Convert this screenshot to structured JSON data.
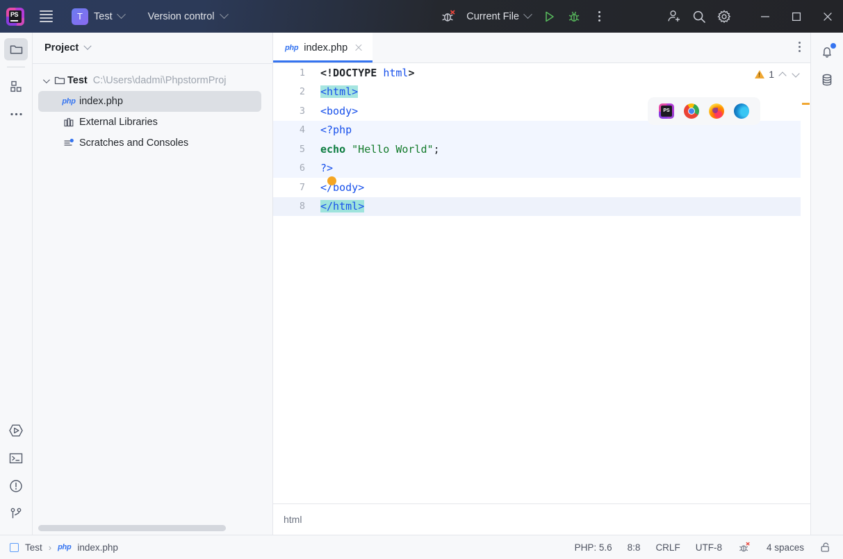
{
  "titlebar": {
    "logo_name": "phpstorm-logo",
    "hamburger_label": "Main Menu",
    "project_initial": "T",
    "project_name": "Test",
    "vcs_label": "Version control",
    "debug_icon_name": "debug-attach-icon",
    "run_config_label": "Current File",
    "run_label": "Run",
    "debug_label": "Debug",
    "more_label": "More Actions",
    "account_label": "Account",
    "search_label": "Search Everywhere",
    "settings_label": "Settings",
    "minimize_label": "Minimize",
    "maximize_label": "Maximize",
    "close_label": "Close"
  },
  "left_rail": {
    "items": [
      {
        "name": "project-tool-window",
        "icon": "folder-icon",
        "active": true
      },
      {
        "name": "commit-tool-window",
        "icon": "structure-icon",
        "active": false
      },
      {
        "name": "more-tool-windows",
        "icon": "more-dots-icon",
        "active": false
      }
    ],
    "bottom_items": [
      {
        "name": "run-tool-window",
        "icon": "run-icon"
      },
      {
        "name": "terminal-tool-window",
        "icon": "terminal-icon"
      },
      {
        "name": "problems-tool-window",
        "icon": "problems-icon"
      },
      {
        "name": "version-control-tool-window",
        "icon": "branch-icon"
      }
    ]
  },
  "right_rail": {
    "items": [
      {
        "name": "notifications",
        "icon": "bell-icon",
        "badge": true
      },
      {
        "name": "database-tool-window",
        "icon": "database-icon",
        "badge": false
      }
    ]
  },
  "project_panel": {
    "title": "Project",
    "tree": [
      {
        "label": "Test",
        "path": "C:\\Users\\dadmi\\PhpstormProj",
        "icon": "folder-icon",
        "expanded": true,
        "bold": true,
        "selected": false,
        "depth": 0
      },
      {
        "label": "index.php",
        "path": "",
        "icon": "php-file-icon",
        "expanded": false,
        "bold": false,
        "selected": true,
        "depth": 1
      },
      {
        "label": "External Libraries",
        "path": "",
        "icon": "library-icon",
        "expanded": false,
        "bold": false,
        "selected": false,
        "depth": 1
      },
      {
        "label": "Scratches and Consoles",
        "path": "",
        "icon": "scratches-icon",
        "expanded": false,
        "bold": false,
        "selected": false,
        "depth": 1
      }
    ]
  },
  "editor": {
    "tab": {
      "label": "index.php",
      "file_type_badge": "php",
      "close_label": "Close Tab"
    },
    "tab_options_label": "Editor Options",
    "inspection": {
      "warning_count": "1",
      "prev_label": "Previous Highlighted Error",
      "next_label": "Next Highlighted Error"
    },
    "browsers": [
      {
        "name": "open-in-phpstorm-builtin-preview",
        "label": "PhpStorm Built-in Preview"
      },
      {
        "name": "open-in-chrome",
        "label": "Chrome"
      },
      {
        "name": "open-in-firefox",
        "label": "Firefox"
      },
      {
        "name": "open-in-edge",
        "label": "Edge"
      }
    ],
    "breadcrumb": "html",
    "lines": [
      {
        "number": "1",
        "text": "<!DOCTYPE html>"
      },
      {
        "number": "2",
        "text": "<html>"
      },
      {
        "number": "3",
        "text": "<body>"
      },
      {
        "number": "4",
        "text": "<?php"
      },
      {
        "number": "5",
        "text": "echo \"Hello World\";"
      },
      {
        "number": "6",
        "text": "?>"
      },
      {
        "number": "7",
        "text": "</body>"
      },
      {
        "number": "8",
        "text": "</html>"
      }
    ]
  },
  "statusbar": {
    "project_name": "Test",
    "separator": "›",
    "file_name": "index.php",
    "file_badge": "php",
    "php_version": "PHP: 5.6",
    "caret_position": "8:8",
    "line_separator": "CRLF",
    "encoding": "UTF-8",
    "debug_icon_name": "debug-status-icon",
    "indent": "4 spaces",
    "lock_icon_name": "unlocked-icon"
  },
  "colors": {
    "accent": "#3574f0",
    "titlebar_left": "#2b3a5c",
    "titlebar_right": "#232428",
    "selection": "#a5e5e0",
    "warning": "#f0a732",
    "panel_bg": "#f7f8fa"
  }
}
